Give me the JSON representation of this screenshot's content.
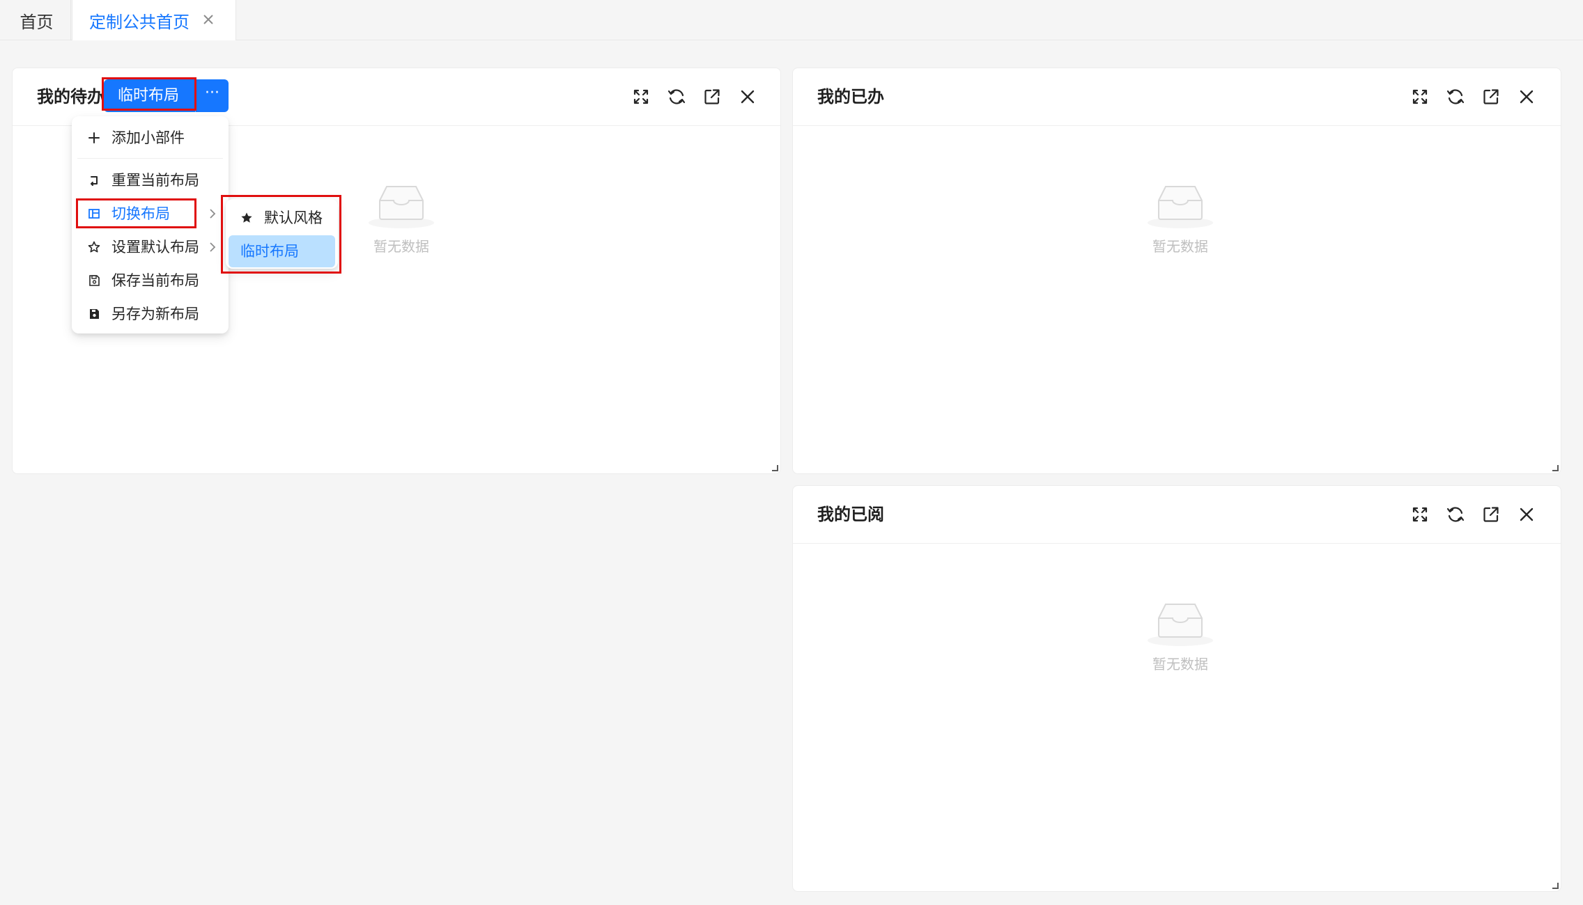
{
  "tabs": [
    {
      "label": "首页"
    },
    {
      "label": "定制公共首页",
      "active": true
    }
  ],
  "layout_button": {
    "label": "临时布局",
    "more": "···"
  },
  "dropdown": {
    "items": [
      {
        "label": "添加小部件",
        "icon": "plus-icon"
      },
      {
        "label": "重置当前布局",
        "icon": "reset-icon"
      },
      {
        "label": "切换布局",
        "icon": "layout-icon",
        "has_submenu": true,
        "active": true
      },
      {
        "label": "设置默认布局",
        "icon": "star-outline-icon",
        "has_submenu": true
      },
      {
        "label": "保存当前布局",
        "icon": "save-icon"
      },
      {
        "label": "另存为新布局",
        "icon": "save-as-icon"
      }
    ]
  },
  "submenu": {
    "items": [
      {
        "label": "默认风格",
        "icon": "star-filled-icon"
      },
      {
        "label": "临时布局",
        "selected": true
      }
    ]
  },
  "cards": {
    "todo": {
      "title": "我的待办",
      "empty_text": "暂无数据"
    },
    "done": {
      "title": "我的已办",
      "empty_text": "暂无数据"
    },
    "read": {
      "title": "我的已阅",
      "empty_text": "暂无数据"
    }
  },
  "colors": {
    "primary": "#1677ff",
    "annotation_red": "#e00f0f",
    "selected_bg": "#bae0ff"
  }
}
